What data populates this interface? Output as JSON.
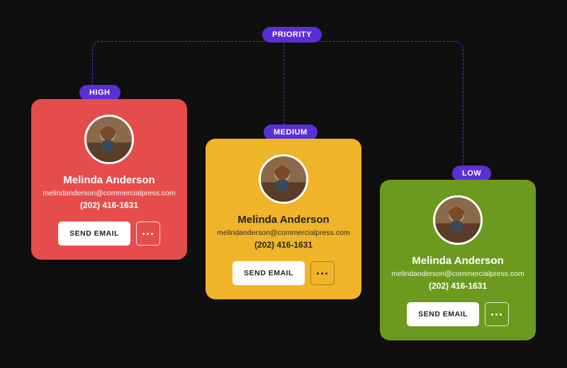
{
  "root": {
    "label": "PRIORITY"
  },
  "branches": {
    "high": {
      "label": "HIGH"
    },
    "medium": {
      "label": "MEDIUM"
    },
    "low": {
      "label": "LOW"
    }
  },
  "cards": {
    "high": {
      "name": "Melinda Anderson",
      "email": "melindanderson@commercialpress.com",
      "phone": "(202) 416-1631",
      "action": "SEND EMAIL",
      "color": "#e74c4c"
    },
    "medium": {
      "name": "Melinda Anderson",
      "email": "melindanderson@commercialpress.com",
      "phone": "(202) 416-1631",
      "action": "SEND EMAIL",
      "color": "#f0b429"
    },
    "low": {
      "name": "Melinda Anderson",
      "email": "melindanderson@commercialpress.com",
      "phone": "(202) 416-1631",
      "action": "SEND EMAIL",
      "color": "#6c9a1f"
    }
  },
  "colors": {
    "accent": "#5b2fd8",
    "background": "#0f0f0f"
  }
}
